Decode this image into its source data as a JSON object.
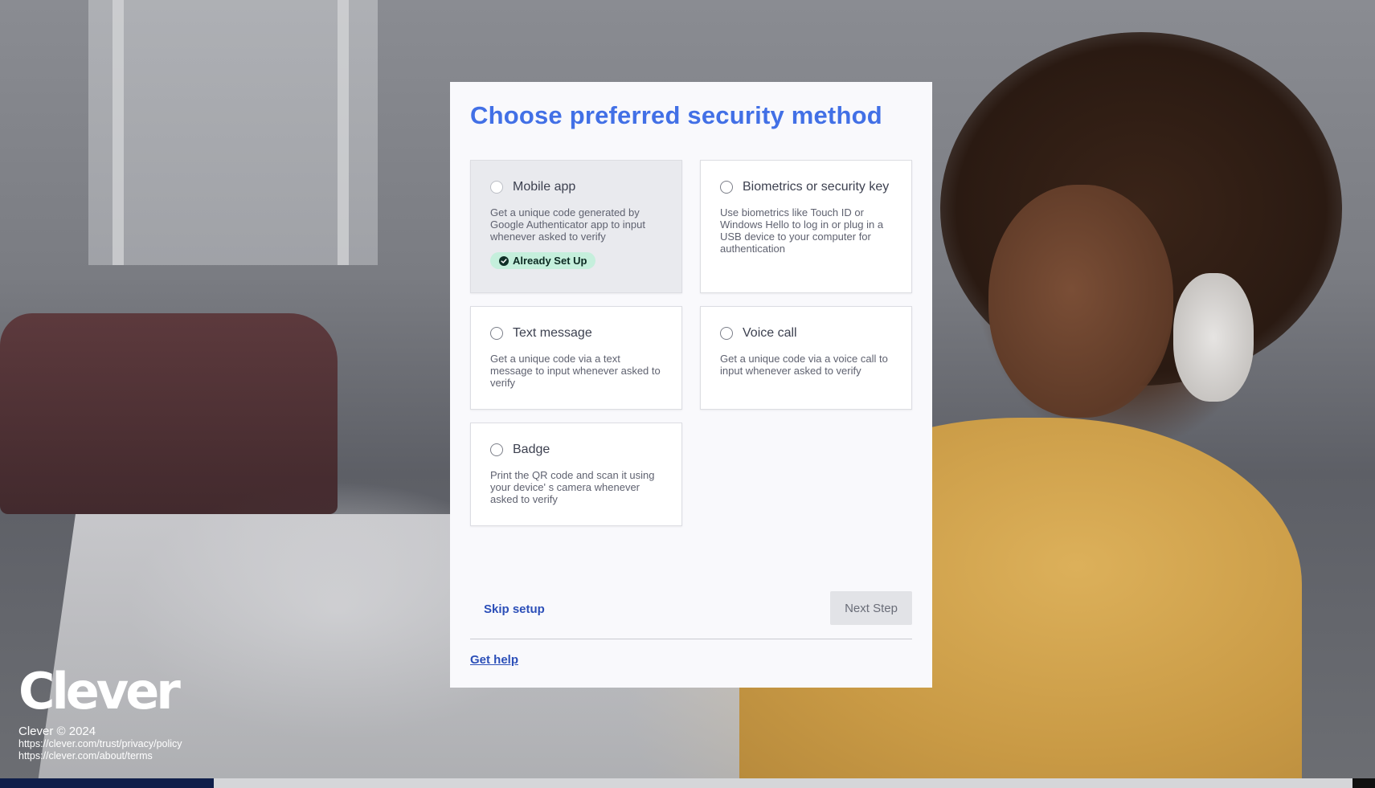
{
  "title": "Choose preferred security method",
  "options": [
    {
      "label": "Mobile app",
      "description": "Get a unique code generated by Google Authenticator app to input whenever asked to verify",
      "badge": "Already Set Up"
    },
    {
      "label": "Biometrics or security key",
      "description": "Use biometrics like Touch ID or Windows Hello to log in or plug in a USB device to your computer for authentication"
    },
    {
      "label": "Text message",
      "description": "Get a unique code via a text message to input whenever asked to verify"
    },
    {
      "label": "Voice call",
      "description": "Get a unique code via a voice call to input whenever asked to verify"
    },
    {
      "label": "Badge",
      "description": "Print the QR code and scan it using your device' s camera whenever asked to verify"
    }
  ],
  "footer": {
    "skip_label": "Skip setup",
    "next_label": "Next Step",
    "help_label": "Get help"
  },
  "brand": {
    "logo_text": "Clever",
    "copyright": "Clever © 2024",
    "privacy_url": "https://clever.com/trust/privacy/policy",
    "terms_url": "https://clever.com/about/terms"
  },
  "colors": {
    "accent": "#4270e6",
    "link": "#2c4fb8",
    "badge_bg": "#c5efdc"
  }
}
